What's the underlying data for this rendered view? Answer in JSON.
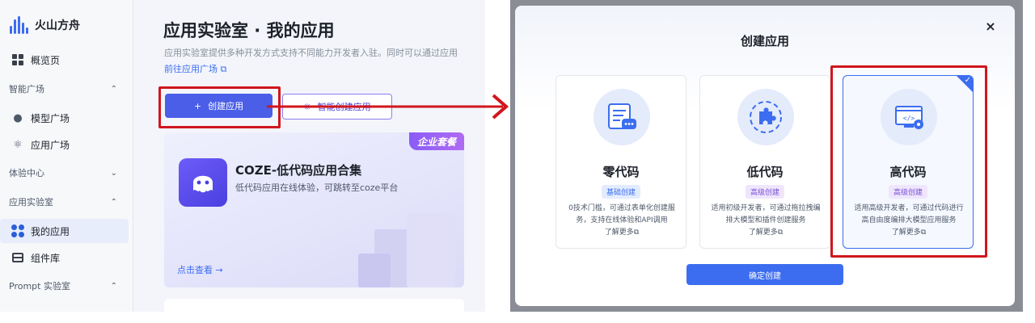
{
  "left": {
    "brand": "火山方舟",
    "sidebar": {
      "overview": "概览页",
      "group_smart_square": "智能广场",
      "model_square": "模型广场",
      "app_square": "应用广场",
      "group_experience": "体验中心",
      "group_app_lab": "应用实验室",
      "my_apps": "我的应用",
      "components": "组件库",
      "group_prompt_lab": "Prompt 实验室"
    },
    "main": {
      "title": "应用实验室 · 我的应用",
      "description": "应用实验室提供多种开发方式支持不同能力开发者入驻。同时可以通过应用",
      "link": "前往应用广场",
      "create_button": "创建应用",
      "smart_create_button": "智能创建应用",
      "card": {
        "badge": "企业套餐",
        "title": "COZE-低代码应用合集",
        "description": "低代码应用在线体验，可跳转至coze平台",
        "link": "点击查看 →"
      }
    },
    "colors": {
      "accent": "#4a5ee8",
      "highlight": "#d0161d"
    }
  },
  "modal": {
    "title": "创建应用",
    "close": "×",
    "options": [
      {
        "title": "零代码",
        "tag": "基础创建",
        "description": "0技术门槛，可通过表单化创建服务，支持在线体验和API调用",
        "more": "了解更多",
        "icon": "form-chat-icon"
      },
      {
        "title": "低代码",
        "tag": "高级创建",
        "description": "适用初级开发者，可通过拖拉拽编排大模型和插件创建服务",
        "more": "了解更多",
        "icon": "puzzle-icon"
      },
      {
        "title": "高代码",
        "tag": "高级创建",
        "description": "适用高级开发者，可通过代码进行高自由度编排大模型应用服务",
        "more": "了解更多",
        "icon": "code-monitor-icon",
        "selected": true
      }
    ],
    "confirm_button": "确定创建",
    "colors": {
      "primary": "#3c6df0"
    }
  }
}
